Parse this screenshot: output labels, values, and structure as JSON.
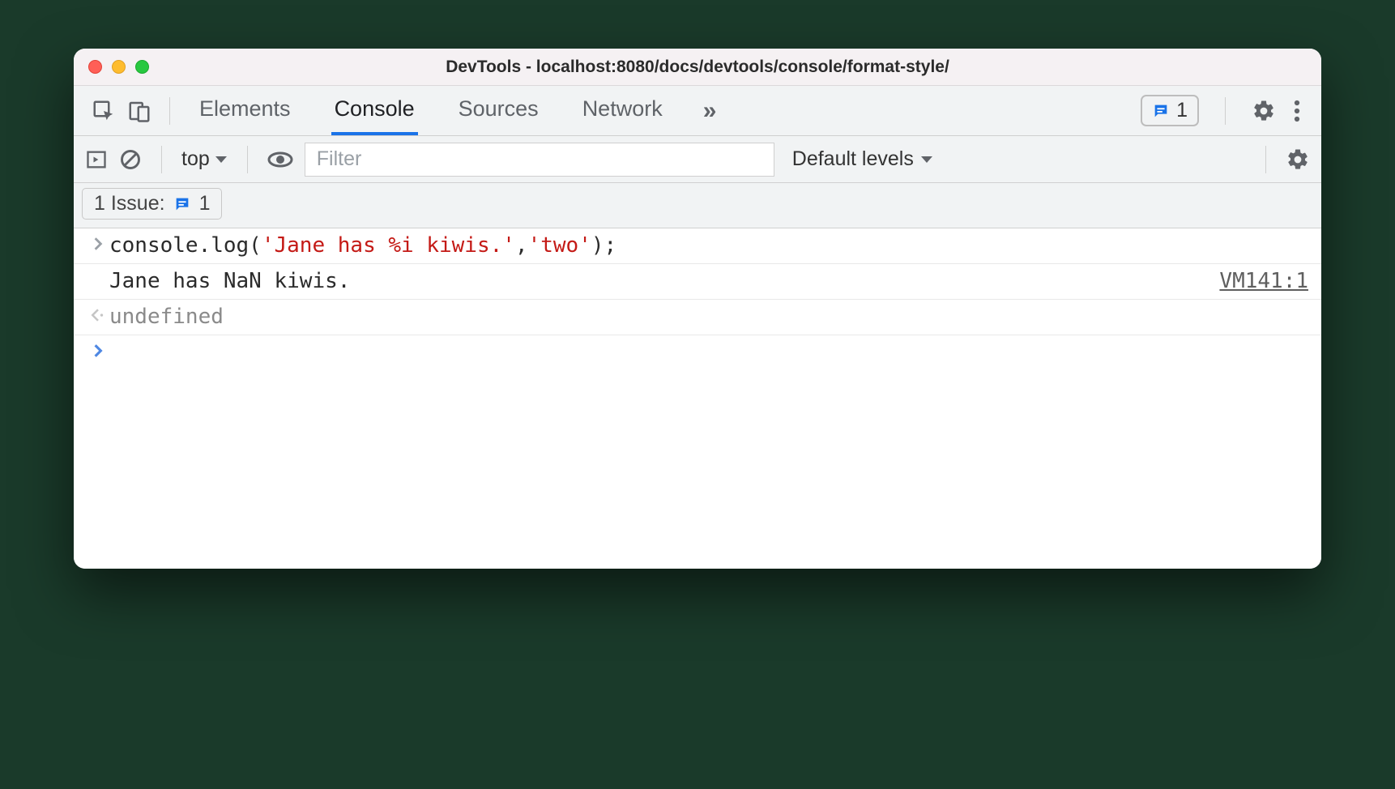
{
  "window": {
    "title": "DevTools - localhost:8080/docs/devtools/console/format-style/"
  },
  "tabs": {
    "elements": "Elements",
    "console": "Console",
    "sources": "Sources",
    "network": "Network"
  },
  "badge": {
    "count": "1"
  },
  "toolbar": {
    "context": "top",
    "filter_placeholder": "Filter",
    "levels": "Default levels"
  },
  "issues": {
    "label": "1 Issue:",
    "count": "1"
  },
  "console": {
    "input_code": {
      "prefix": "console.log(",
      "str1": "'Jane has %i kiwis.'",
      "sep": ", ",
      "str2": "'two'",
      "suffix": ");"
    },
    "output_text": "Jane has NaN kiwis.",
    "output_source": "VM141:1",
    "return_value": "undefined"
  }
}
